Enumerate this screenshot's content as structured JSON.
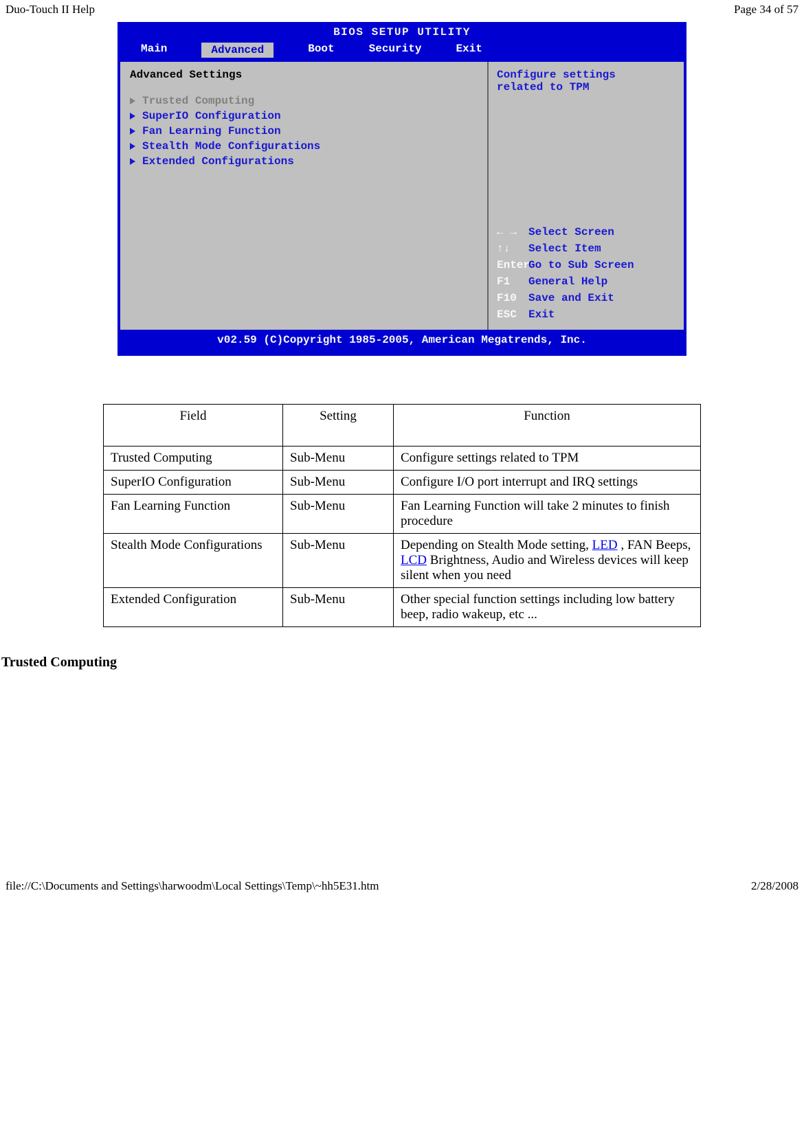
{
  "header": {
    "left": "Duo-Touch II Help",
    "right": "Page 34 of 57"
  },
  "footer": {
    "left": "file://C:\\Documents and Settings\\harwoodm\\Local Settings\\Temp\\~hh5E31.htm",
    "right": "2/28/2008"
  },
  "bios": {
    "title": "BIOS SETUP UTILITY",
    "tabs": [
      "Main",
      "Advanced",
      "Boot",
      "Security",
      "Exit"
    ],
    "active_tab_index": 1,
    "panel_heading": "Advanced Settings",
    "menu_items": [
      {
        "label": "Trusted Computing",
        "dim": true
      },
      {
        "label": "SuperIO Configuration",
        "dim": false
      },
      {
        "label": "Fan Learning Function",
        "dim": false
      },
      {
        "label": "Stealth Mode Configurations",
        "dim": false
      },
      {
        "label": "Extended Configurations",
        "dim": false
      }
    ],
    "help_text_line1": "Configure settings",
    "help_text_line2": "related to TPM",
    "keys": [
      {
        "key": "← →",
        "label": "Select Screen"
      },
      {
        "key": "↑↓",
        "label": "Select Item"
      },
      {
        "key": "Enter",
        "label": "Go to Sub Screen"
      },
      {
        "key": "F1",
        "label": "General Help"
      },
      {
        "key": "F10",
        "label": "Save and Exit"
      },
      {
        "key": "ESC",
        "label": "Exit"
      }
    ],
    "copyright": "v02.59 (C)Copyright 1985-2005, American Megatrends, Inc."
  },
  "table": {
    "headers": [
      "Field",
      "Setting",
      "Function"
    ],
    "rows": [
      {
        "field": "Trusted Computing",
        "setting": "Sub-Menu",
        "function_parts": [
          {
            "text": "Configure settings related to TPM"
          }
        ]
      },
      {
        "field": "SuperIO Configuration",
        "setting": "Sub-Menu",
        "function_parts": [
          {
            "text": "Configure I/O port interrupt and IRQ settings"
          }
        ]
      },
      {
        "field": "Fan Learning Function",
        "setting": "Sub-Menu",
        "function_parts": [
          {
            "text": "Fan Learning Function will take 2 minutes to finish procedure"
          }
        ]
      },
      {
        "field": "Stealth Mode Configurations",
        "setting": "Sub-Menu",
        "function_parts": [
          {
            "text": "Depending on Stealth Mode setting, "
          },
          {
            "text": "LED",
            "link": true
          },
          {
            "text": " , FAN Beeps, "
          },
          {
            "text": "LCD",
            "link": true
          },
          {
            "text": " Brightness, Audio and Wireless devices will keep silent when you need"
          }
        ]
      },
      {
        "field": "Extended Configuration",
        "setting": "Sub-Menu",
        "function_parts": [
          {
            "text": "Other special function settings including low battery beep, radio wakeup, etc ..."
          }
        ]
      }
    ]
  },
  "section_heading": "Trusted Computing"
}
